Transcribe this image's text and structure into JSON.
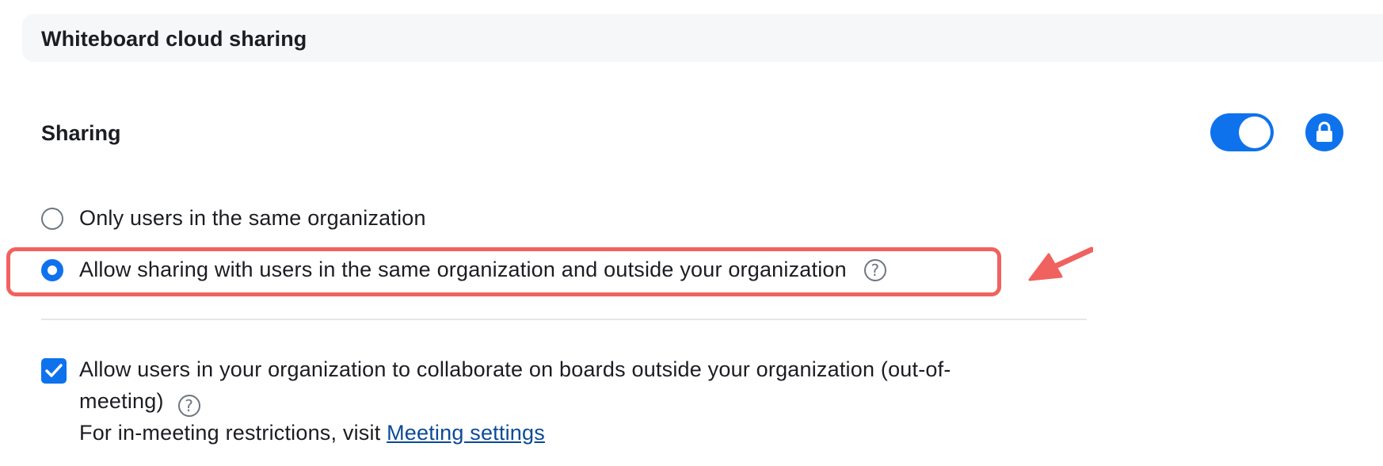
{
  "section": {
    "title": "Whiteboard cloud sharing"
  },
  "setting": {
    "title": "Sharing",
    "toggle_on": true,
    "locked": true
  },
  "options": [
    {
      "label": "Only users in the same organization",
      "selected": false
    },
    {
      "label": "Allow sharing with users in the same organization and outside your organization",
      "selected": true,
      "help_icon": "?"
    }
  ],
  "collaborate": {
    "checked": true,
    "line1": "Allow users in your organization to collaborate on boards outside your organization (out-of-",
    "line2": "meeting)",
    "help_icon": "?",
    "note_prefix": "For in-meeting restrictions, visit ",
    "link_text": "Meeting settings"
  },
  "colors": {
    "accent": "#0e72ed",
    "highlight": "#f0625f",
    "link": "#0b4a99"
  },
  "icons": {
    "lock": "lock-icon",
    "help": "question-circle-icon",
    "check": "checkmark-icon",
    "annotation": "arrow-icon"
  }
}
